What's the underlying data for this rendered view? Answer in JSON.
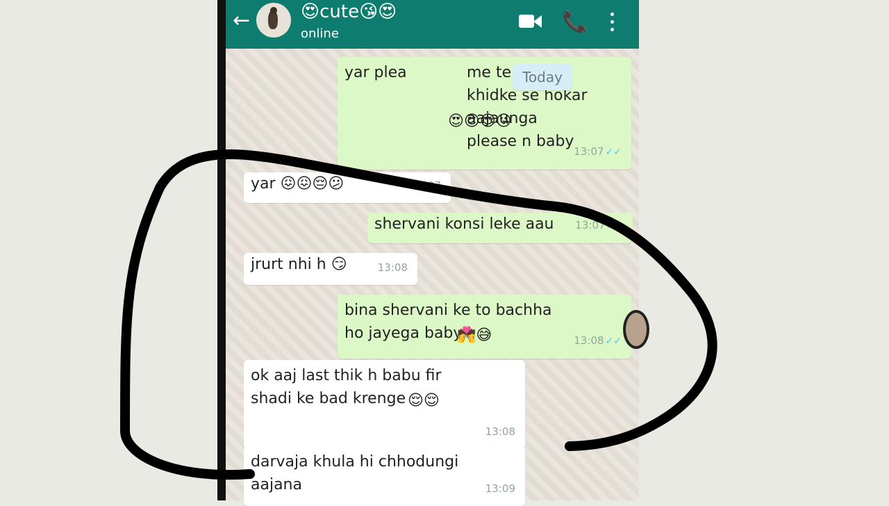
{
  "contact": {
    "name_left_emoji": "😍",
    "name": "cute",
    "name_right_emoji": "😘😍",
    "status": "online",
    "back_glyph": "←"
  },
  "header_icons": {
    "video": "video-call-icon",
    "phone": "phone-call-icon",
    "menu": "more-options-icon"
  },
  "date_divider": "Today",
  "messages": [
    {
      "dir": "out",
      "text": "yar plea",
      "text2": "me tere\nkhidke se hokar aajaunga\nplease n baby",
      "time": "13:07",
      "emojis": "😍😍😍😘"
    },
    {
      "dir": "in",
      "text": "yar",
      "time": "13:07",
      "emojis": "😖😖😔😕"
    },
    {
      "dir": "out",
      "text": "shervani konsi leke aau",
      "time": "13:07",
      "emojis": ""
    },
    {
      "dir": "in",
      "text": "jrurt nhi h",
      "time": "13:08",
      "emojis": "😏"
    },
    {
      "dir": "out",
      "text": "bina shervani ke to bachha\nho jayega baby",
      "time": "13:08",
      "emojis": "💏😅"
    },
    {
      "dir": "in",
      "text": "ok aaj last thik h babu fir\nshadi ke bad krenge",
      "time": "13:08",
      "emojis": "😌😌"
    },
    {
      "dir": "in",
      "text": "darvaja khula hi chhodungi\naajana",
      "time": "13:09",
      "emojis": ""
    }
  ],
  "accent_colors": {
    "header": "#0e7c6f",
    "outgoing_bubble": "#dcf8c6",
    "incoming_bubble": "#ffffff",
    "read_ticks": "#4fc3f7",
    "annotation": "#000000"
  }
}
